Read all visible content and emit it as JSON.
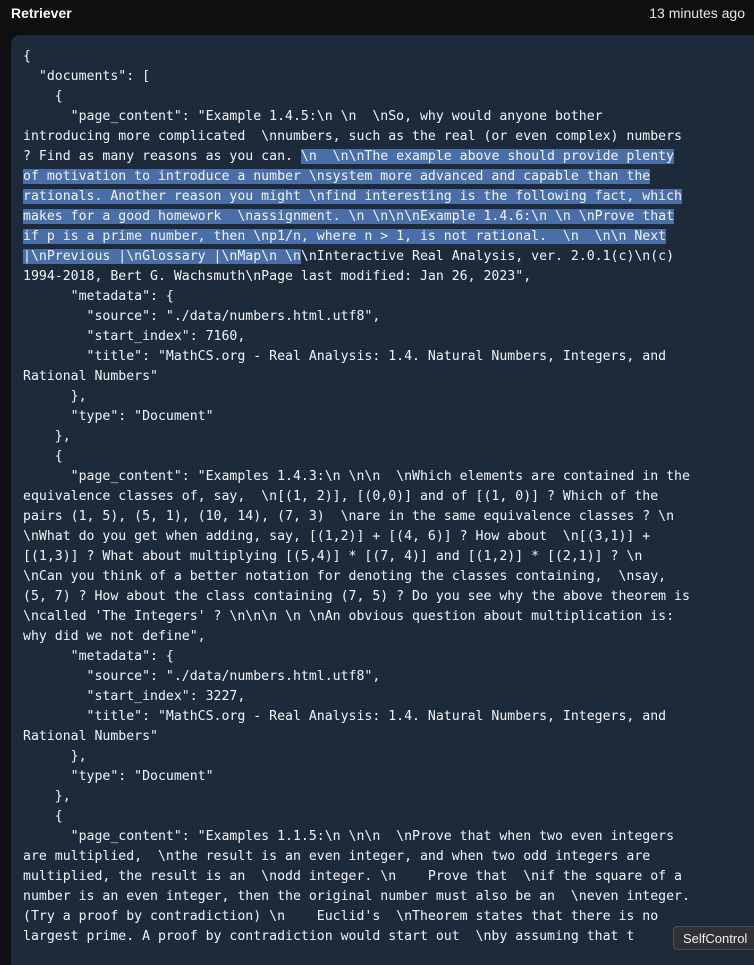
{
  "header": {
    "title": "Retriever",
    "time": "13 minutes ago"
  },
  "code": {
    "l1": "{",
    "l2": "  \"documents\": [",
    "l3": "    {",
    "l4": "      \"page_content\": \"Example 1.4.5:\\n \\n  \\nSo, why would anyone bother",
    "l5": "introducing more complicated  \\nnumbers, such as the real (or even complex) numbers",
    "l6a": "? Find as many reasons as you can. ",
    "l6b": "\\n  \\n\\nThe example above should provide plenty",
    "l7": "of motivation to introduce a number \\nsystem more advanced and capable than the",
    "l8": "rationals. Another reason you might \\nfind interesting is the following fact, which",
    "l9": "makes for a good homework  \\nassignment. \\n \\n\\n\\nExample 1.4.6:\\n \\n \\nProve that",
    "l10": "if p is a prime number, then \\np1/n, where n > 1, is not rational.  \\n  \\n\\n Next",
    "l11a": "|\\nPrevious |\\nGlossary |\\nMap\\n \\n",
    "l11b": "\\nInteractive Real Analysis, ver. 2.0.1(c)\\n(c)",
    "l12": "1994-2018, Bert G. Wachsmuth\\nPage last modified: Jan 26, 2023\",",
    "l13": "      \"metadata\": {",
    "l14": "        \"source\": \"./data/numbers.html.utf8\",",
    "l15": "        \"start_index\": 7160,",
    "l16": "        \"title\": \"MathCS.org - Real Analysis: 1.4. Natural Numbers, Integers, and",
    "l17": "Rational Numbers\"",
    "l18": "      },",
    "l19": "      \"type\": \"Document\"",
    "l20": "    },",
    "l21": "    {",
    "l22": "      \"page_content\": \"Examples 1.4.3:\\n \\n\\n  \\nWhich elements are contained in the",
    "l23": "equivalence classes of, say,  \\n[(1, 2)], [(0,0)] and of [(1, 0)] ? Which of the",
    "l24": "pairs (1, 5), (5, 1), (10, 14), (7, 3)  \\nare in the same equivalence classes ? \\n",
    "l25": "\\nWhat do you get when adding, say, [(1,2)] + [(4, 6)] ? How about  \\n[(3,1)] +",
    "l26": "[(1,3)] ? What about multiplying [(5,4)] * [(7, 4)] and [(1,2)] * [(2,1)] ? \\n",
    "l27": "\\nCan you think of a better notation for denoting the classes containing,  \\nsay,",
    "l28": "(5, 7) ? How about the class containing (7, 5) ? Do you see why the above theorem is",
    "l29": "\\ncalled 'The Integers' ? \\n\\n\\n \\n \\nAn obvious question about multiplication is:",
    "l30": "why did we not define\",",
    "l31": "      \"metadata\": {",
    "l32": "        \"source\": \"./data/numbers.html.utf8\",",
    "l33": "        \"start_index\": 3227,",
    "l34": "        \"title\": \"MathCS.org - Real Analysis: 1.4. Natural Numbers, Integers, and",
    "l35": "Rational Numbers\"",
    "l36": "      },",
    "l37": "      \"type\": \"Document\"",
    "l38": "    },",
    "l39": "    {",
    "l40": "      \"page_content\": \"Examples 1.1.5:\\n \\n\\n  \\nProve that when two even integers",
    "l41": "are multiplied,  \\nthe result is an even integer, and when two odd integers are",
    "l42": "multiplied, the result is an  \\nodd integer. \\n    Prove that  \\nif the square of a",
    "l43": "number is an even integer, then the original number must also be an  \\neven integer.",
    "l44": "(Try a proof by contradiction) \\n    Euclid's  \\nTheorem states that there is no",
    "l45": "largest prime. A proof by contradiction would start out  \\nby assuming that t"
  },
  "footer": {
    "button_label": "SelfControl"
  }
}
